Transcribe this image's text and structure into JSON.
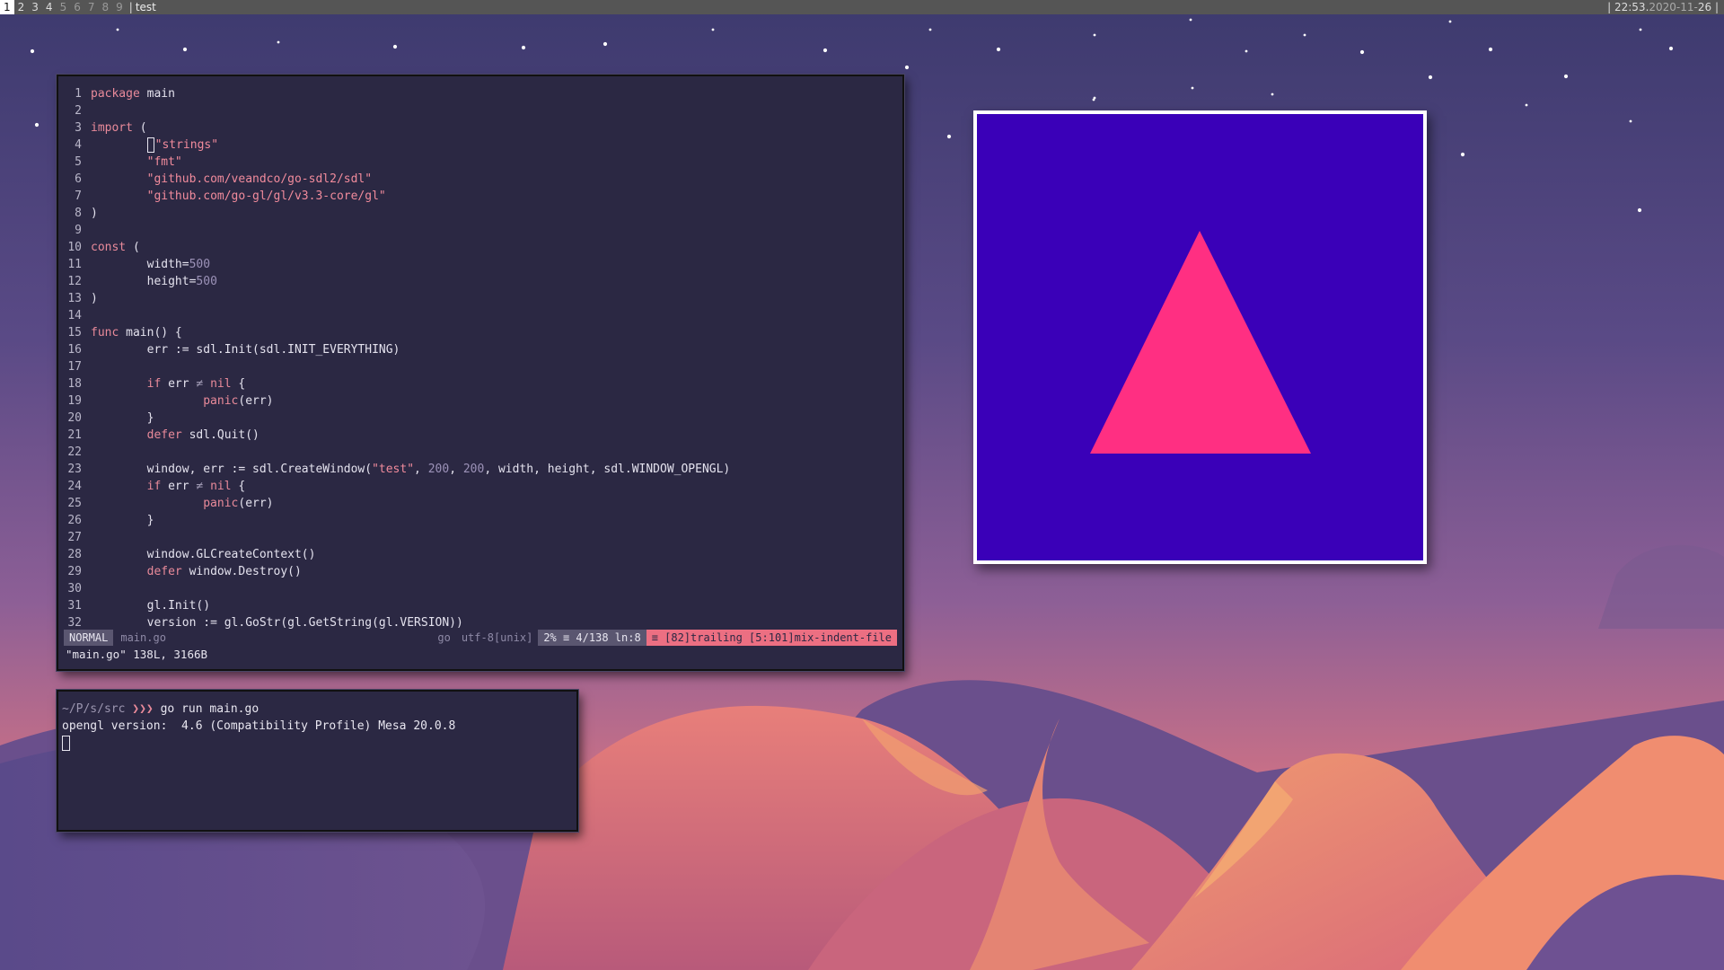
{
  "topbar": {
    "workspaces": [
      "1",
      "2",
      "3",
      "4",
      "5",
      "6",
      "7",
      "8",
      "9"
    ],
    "active_workspace": "1",
    "window_title": "test",
    "time": "22:53.",
    "date": "2020-11-",
    "day": "26"
  },
  "editor": {
    "lines": [
      {
        "n": "1",
        "parts": [
          [
            "kw",
            "package"
          ],
          [
            "txt",
            " main"
          ]
        ]
      },
      {
        "n": "2",
        "parts": []
      },
      {
        "n": "3",
        "parts": [
          [
            "kw",
            "import"
          ],
          [
            "txt",
            " ("
          ]
        ]
      },
      {
        "n": "4",
        "parts": [
          [
            "cursor",
            ""
          ],
          [
            "str",
            "\"strings\""
          ]
        ],
        "indent": "        "
      },
      {
        "n": "5",
        "parts": [
          [
            "str",
            "\"fmt\""
          ]
        ],
        "indent": "        "
      },
      {
        "n": "6",
        "parts": [
          [
            "str",
            "\"github.com/veandco/go-sdl2/sdl\""
          ]
        ],
        "indent": "        "
      },
      {
        "n": "7",
        "parts": [
          [
            "str",
            "\"github.com/go-gl/gl/v3.3-core/gl\""
          ]
        ],
        "indent": "        "
      },
      {
        "n": "8",
        "parts": [
          [
            "txt",
            ")"
          ]
        ]
      },
      {
        "n": "9",
        "parts": []
      },
      {
        "n": "10",
        "parts": [
          [
            "kw",
            "const"
          ],
          [
            "txt",
            " ("
          ]
        ]
      },
      {
        "n": "11",
        "parts": [
          [
            "txt",
            "width="
          ],
          [
            "num",
            "500"
          ]
        ],
        "indent": "        "
      },
      {
        "n": "12",
        "parts": [
          [
            "txt",
            "height="
          ],
          [
            "num",
            "500"
          ]
        ],
        "indent": "        "
      },
      {
        "n": "13",
        "parts": [
          [
            "txt",
            ")"
          ]
        ]
      },
      {
        "n": "14",
        "parts": []
      },
      {
        "n": "15",
        "parts": [
          [
            "kw",
            "func"
          ],
          [
            "txt",
            " main() {"
          ]
        ]
      },
      {
        "n": "16",
        "parts": [
          [
            "txt",
            "err := sdl.Init(sdl.INIT_EVERYTHING)"
          ]
        ],
        "indent": "        "
      },
      {
        "n": "17",
        "parts": []
      },
      {
        "n": "18",
        "parts": [
          [
            "kw",
            "if"
          ],
          [
            "txt",
            " err "
          ],
          [
            "op",
            "≠"
          ],
          [
            "txt",
            " "
          ],
          [
            "kw",
            "nil"
          ],
          [
            "txt",
            " {"
          ]
        ],
        "indent": "        "
      },
      {
        "n": "19",
        "parts": [
          [
            "fn",
            "panic"
          ],
          [
            "txt",
            "(err)"
          ]
        ],
        "indent": "                "
      },
      {
        "n": "20",
        "parts": [
          [
            "txt",
            "}"
          ]
        ],
        "indent": "        "
      },
      {
        "n": "21",
        "parts": [
          [
            "kw",
            "defer"
          ],
          [
            "txt",
            " sdl.Quit()"
          ]
        ],
        "indent": "        "
      },
      {
        "n": "22",
        "parts": []
      },
      {
        "n": "23",
        "parts": [
          [
            "txt",
            "window, err := sdl.CreateWindow("
          ],
          [
            "str",
            "\"test\""
          ],
          [
            "txt",
            ", "
          ],
          [
            "num",
            "200"
          ],
          [
            "txt",
            ", "
          ],
          [
            "num",
            "200"
          ],
          [
            "txt",
            ", width, height, sdl.WINDOW_OPENGL)"
          ]
        ],
        "indent": "        "
      },
      {
        "n": "24",
        "parts": [
          [
            "kw",
            "if"
          ],
          [
            "txt",
            " err "
          ],
          [
            "op",
            "≠"
          ],
          [
            "txt",
            " "
          ],
          [
            "kw",
            "nil"
          ],
          [
            "txt",
            " {"
          ]
        ],
        "indent": "        "
      },
      {
        "n": "25",
        "parts": [
          [
            "fn",
            "panic"
          ],
          [
            "txt",
            "(err)"
          ]
        ],
        "indent": "                "
      },
      {
        "n": "26",
        "parts": [
          [
            "txt",
            "}"
          ]
        ],
        "indent": "        "
      },
      {
        "n": "27",
        "parts": []
      },
      {
        "n": "28",
        "parts": [
          [
            "txt",
            "window.GLCreateContext()"
          ]
        ],
        "indent": "        "
      },
      {
        "n": "29",
        "parts": [
          [
            "kw",
            "defer"
          ],
          [
            "txt",
            " window.Destroy()"
          ]
        ],
        "indent": "        "
      },
      {
        "n": "30",
        "parts": []
      },
      {
        "n": "31",
        "parts": [
          [
            "txt",
            "gl.Init()"
          ]
        ],
        "indent": "        "
      },
      {
        "n": "32",
        "parts": [
          [
            "txt",
            "version := gl.GoStr(gl.GetString(gl.VERSION))"
          ]
        ],
        "indent": "        "
      }
    ],
    "status": {
      "mode": "NORMAL",
      "file": "main.go",
      "filetype": "go",
      "encoding": "utf-8[unix]",
      "position": "2% ≡ 4/138 ln:8",
      "warnings": "≡ [82]trailing [5:101]mix-indent-file"
    },
    "cmdline": "\"main.go\" 138L, 3166B"
  },
  "terminal": {
    "prompt_path": "~/P/s/src",
    "prompt_arrow": "❯❯❯",
    "command": " go run main.go",
    "output": "opengl version:  4.6 (Compatibility Profile) Mesa 20.0.8"
  },
  "colors": {
    "gl_background": "#3a00b8",
    "triangle": "#ff2f82"
  }
}
